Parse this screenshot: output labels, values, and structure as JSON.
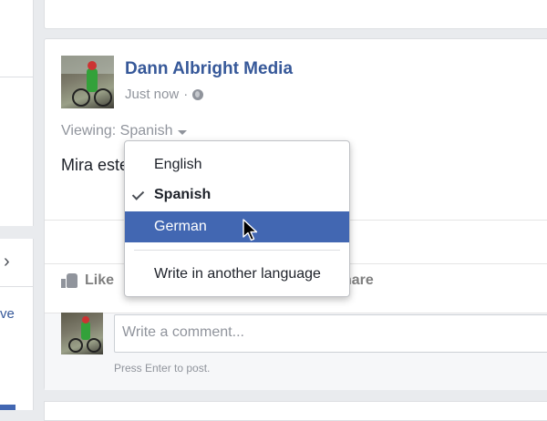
{
  "left_rail": {
    "arrow": "›",
    "truncated_link": "ve"
  },
  "post": {
    "author": "Dann Albright Media",
    "timestamp": "Just now",
    "separator": "·",
    "viewing_label": "Viewing:",
    "viewing_language": "Spanish",
    "text": "Mira este video"
  },
  "actions": {
    "like_label": "Like",
    "share_label_visible": "hare"
  },
  "comment": {
    "placeholder": "Write a comment...",
    "hint": "Press Enter to post."
  },
  "language_menu": {
    "items": [
      {
        "label": "English",
        "checked": false,
        "highlighted": false
      },
      {
        "label": "Spanish",
        "checked": true,
        "highlighted": false
      },
      {
        "label": "German",
        "checked": false,
        "highlighted": true
      }
    ],
    "other_label": "Write in another language"
  },
  "colors": {
    "accent": "#4267b2",
    "link": "#365899",
    "muted": "#90949c",
    "page_bg": "#e9ebee"
  }
}
